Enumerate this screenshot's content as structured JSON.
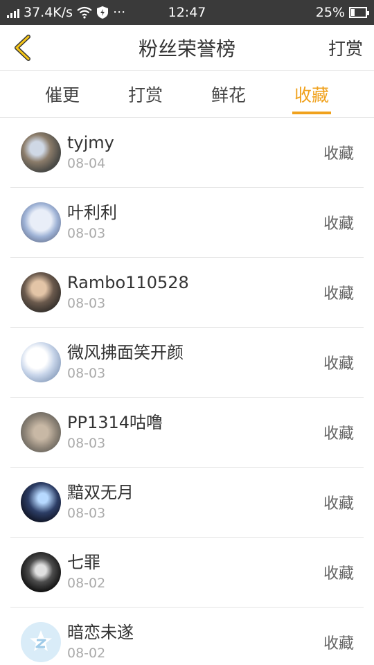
{
  "status_bar": {
    "net_speed": "37.4K/s",
    "time": "12:47",
    "battery": "25%",
    "battery_level": 0.25
  },
  "nav": {
    "title": "粉丝荣誉榜",
    "action": "打赏"
  },
  "tabs": [
    {
      "label": "催更",
      "active": false
    },
    {
      "label": "打赏",
      "active": false
    },
    {
      "label": "鲜花",
      "active": false
    },
    {
      "label": "收藏",
      "active": true
    }
  ],
  "colors": {
    "accent": "#f0a11c",
    "status_bar": "#3a3a3a"
  },
  "fans": [
    {
      "name": "tyjmy",
      "date": "08-04",
      "action": "收藏"
    },
    {
      "name": "叶利利",
      "date": "08-03",
      "action": "收藏"
    },
    {
      "name": "Rambo110528",
      "date": "08-03",
      "action": "收藏"
    },
    {
      "name": "微风拂面笑开颜",
      "date": "08-03",
      "action": "收藏"
    },
    {
      "name": "PP1314咕噜",
      "date": "08-03",
      "action": "收藏"
    },
    {
      "name": "黯双无月",
      "date": "08-03",
      "action": "收藏"
    },
    {
      "name": "七罪",
      "date": "08-02",
      "action": "收藏"
    },
    {
      "name": "暗恋未遂",
      "date": "08-02",
      "action": "收藏"
    }
  ]
}
